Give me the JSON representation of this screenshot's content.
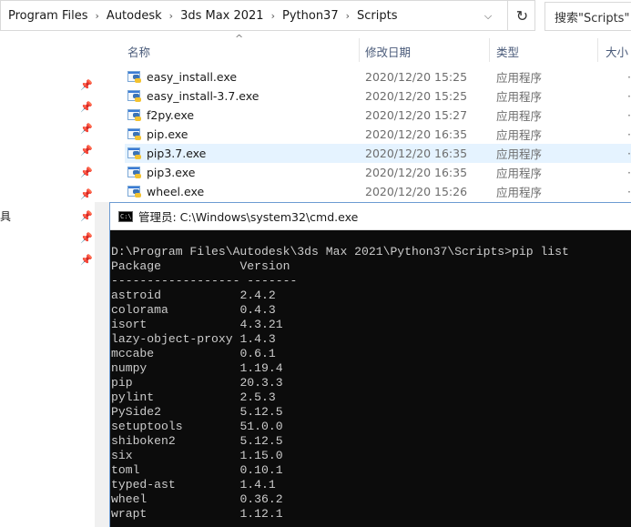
{
  "explorer": {
    "breadcrumb": [
      "Program Files",
      "Autodesk",
      "3ds Max 2021",
      "Python37",
      "Scripts"
    ],
    "search_placeholder": "搜索\"Scripts\"",
    "columns": {
      "name": "名称",
      "date": "修改日期",
      "type": "类型",
      "size": "大小"
    },
    "left_stub": "具",
    "files": [
      {
        "name": "easy_install.exe",
        "date": "2020/12/20 15:25",
        "type": "应用程序"
      },
      {
        "name": "easy_install-3.7.exe",
        "date": "2020/12/20 15:25",
        "type": "应用程序"
      },
      {
        "name": "f2py.exe",
        "date": "2020/12/20 15:27",
        "type": "应用程序"
      },
      {
        "name": "pip.exe",
        "date": "2020/12/20 16:35",
        "type": "应用程序"
      },
      {
        "name": "pip3.7.exe",
        "date": "2020/12/20 16:35",
        "type": "应用程序",
        "selected": true
      },
      {
        "name": "pip3.exe",
        "date": "2020/12/20 16:35",
        "type": "应用程序"
      },
      {
        "name": "wheel.exe",
        "date": "2020/12/20 15:26",
        "type": "应用程序"
      }
    ]
  },
  "cmd": {
    "title": "管理员: C:\\Windows\\system32\\cmd.exe",
    "icon_text": "C:\\",
    "prompt": "D:\\Program Files\\Autodesk\\3ds Max 2021\\Python37\\Scripts>pip list",
    "header": [
      "Package",
      "Version"
    ],
    "separator": [
      "------------------",
      "-------"
    ],
    "packages": [
      [
        "astroid",
        "2.4.2"
      ],
      [
        "colorama",
        "0.4.3"
      ],
      [
        "isort",
        "4.3.21"
      ],
      [
        "lazy-object-proxy",
        "1.4.3"
      ],
      [
        "mccabe",
        "0.6.1"
      ],
      [
        "numpy",
        "1.19.4"
      ],
      [
        "pip",
        "20.3.3"
      ],
      [
        "pylint",
        "2.5.3"
      ],
      [
        "PySide2",
        "5.12.5"
      ],
      [
        "setuptools",
        "51.0.0"
      ],
      [
        "shiboken2",
        "5.12.5"
      ],
      [
        "six",
        "1.15.0"
      ],
      [
        "toml",
        "0.10.1"
      ],
      [
        "typed-ast",
        "1.4.1"
      ],
      [
        "wheel",
        "0.36.2"
      ],
      [
        "wrapt",
        "1.12.1"
      ]
    ]
  }
}
